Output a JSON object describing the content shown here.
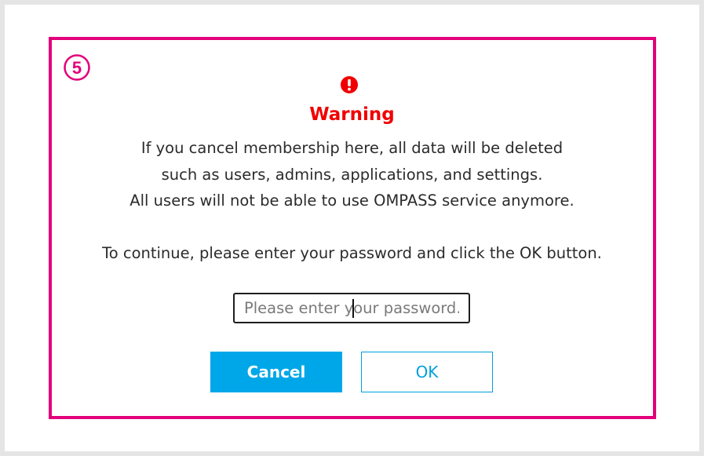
{
  "step": {
    "badge_number": "⑤"
  },
  "dialog": {
    "title": "Warning",
    "message_lines": [
      "If you cancel membership here, all data will be deleted",
      "such as users, admins, applications, and settings.",
      "All users will not be able to use OMPASS service anymore."
    ],
    "instruction": "To continue, please enter your password and click the OK button.",
    "password": {
      "value": "",
      "placeholder": "Please enter your password."
    },
    "buttons": {
      "cancel_label": "Cancel",
      "ok_label": "OK"
    }
  },
  "colors": {
    "highlight_border": "#e2007a",
    "warning": "#f00000",
    "primary_button": "#00a7e8",
    "secondary_button_border": "#00a0dc",
    "frame": "#e5e5e5"
  },
  "icons": {
    "step_badge": "circled-number-five-icon",
    "warning": "exclamation-circle-icon"
  }
}
